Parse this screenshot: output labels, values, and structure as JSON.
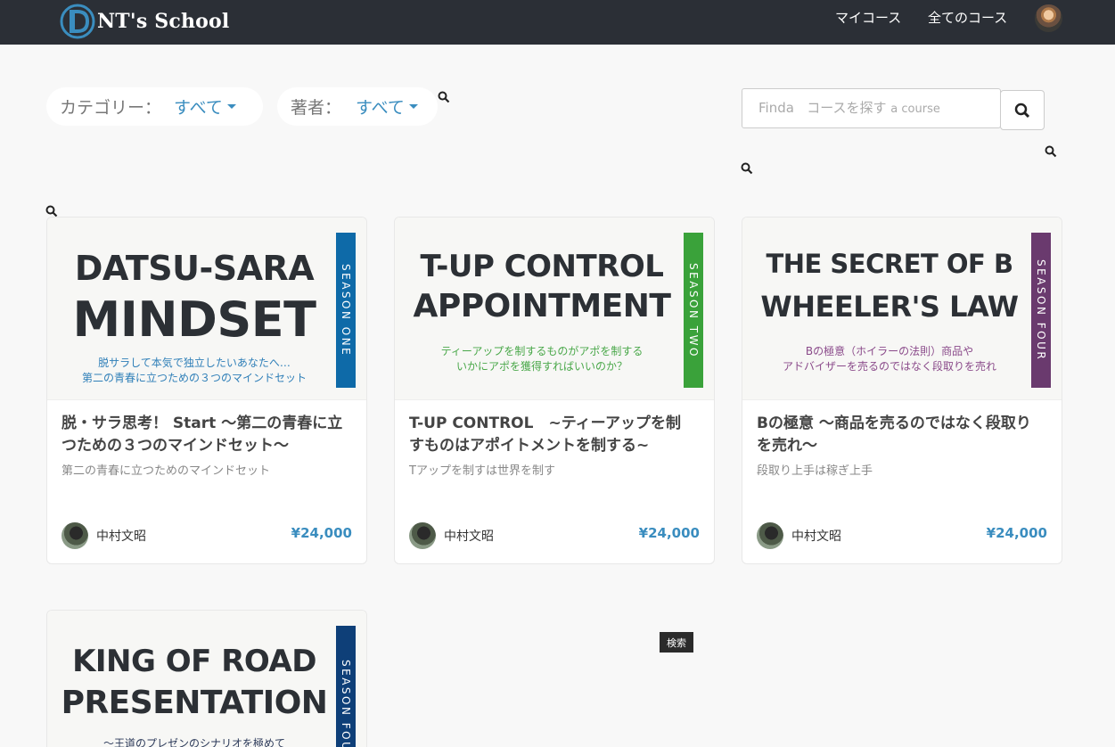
{
  "nav": {
    "brand": "NT's School",
    "my_courses": "マイコース",
    "all_courses": "全てのコース"
  },
  "filters": {
    "category_label": "カテゴリー：",
    "category_value": "すべて",
    "author_label": "著者：",
    "author_value": "すべて"
  },
  "search": {
    "placeholder_a": "Finda",
    "placeholder_b": "コースを探す",
    "placeholder_c": "a course",
    "tooltip": "検索"
  },
  "courses": [
    {
      "cover_line1": "DATSU-SARA",
      "cover_line2": "MINDSET",
      "cover_sub1": "脱サラして本気で独立したいあなたへ…",
      "cover_sub2": "第二の青春に立つための３つのマインドセット",
      "season": "SEASON ONE",
      "season_color": "#0e6aa8",
      "sub_color": "#2f7fb8",
      "title": "脱・サラ思考！ Start ～第二の青春に立つための３つのマインドセット～",
      "desc": "第二の青春に立つためのマインドセット",
      "author": "中村文昭",
      "price": "¥24,000"
    },
    {
      "cover_line1": "T-UP CONTROL",
      "cover_line2": "APPOINTMENT",
      "cover_sub1": "ティーアップを制するものがアポを制する",
      "cover_sub2": "いかにアポを獲得すればいいのか？",
      "season": "SEASON TWO",
      "season_color": "#3aa23a",
      "sub_color": "#4aa84a",
      "title": "T-UP CONTROL　~ティーアップを制すものはアポイトメントを制する~",
      "desc": "Tアップを制すは世界を制す",
      "author": "中村文昭",
      "price": "¥24,000"
    },
    {
      "cover_line1": "THE SECRET OF B",
      "cover_line2": "WHEELER'S LAW",
      "cover_sub1": "Bの極意（ホイラーの法則）商品や",
      "cover_sub2": "アドバイザーを売るのではなく段取りを売れ",
      "season": "SEASON FOUR",
      "season_color": "#6a3a6e",
      "sub_color": "#8a4a8a",
      "title": "Bの極意 ～商品を売るのではなく段取りを売れ～",
      "desc": "段取り上手は稼ぎ上手",
      "author": "中村文昭",
      "price": "¥24,000"
    },
    {
      "cover_line1": "KING OF ROAD",
      "cover_line2": "PRESENTATION",
      "cover_sub1": "～王道のプレゼンのシナリオを極めて",
      "cover_sub2": "",
      "season": "SEASON FOUR",
      "season_color": "#0e3f78",
      "sub_color": "#2c3a5a"
    }
  ]
}
